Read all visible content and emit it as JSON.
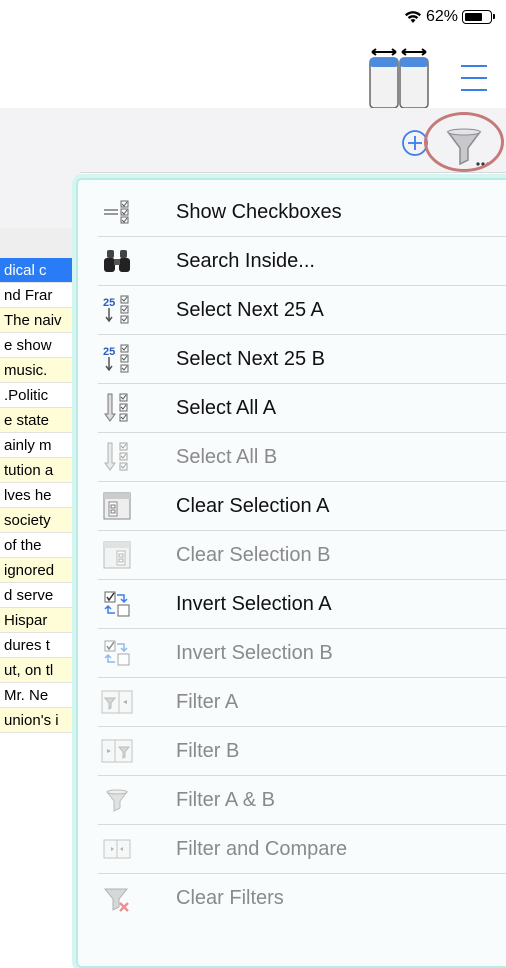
{
  "status_bar": {
    "battery_percent": "62%"
  },
  "toolbar": {
    "columns_icon": "two-columns-icon",
    "menu_icon": "hamburger-icon",
    "add_icon": "plus-circle-icon",
    "filter_icon": "filter-funnel-icon"
  },
  "background_rows": [
    "dical c",
    "nd Frar",
    "The naiv",
    "e show",
    " music.",
    ".Politic",
    "e state",
    "ainly m",
    "tution a",
    "lves he",
    "society",
    " of the",
    "ignored",
    "d serve",
    " Hispar",
    "dures t",
    "ut, on tl",
    "Mr. Ne",
    "union's i"
  ],
  "menu": {
    "items": [
      {
        "label": "Show Checkboxes",
        "icon": "checkbox-list-icon",
        "enabled": true
      },
      {
        "label": "Search Inside...",
        "icon": "binoculars-icon",
        "enabled": true
      },
      {
        "label": "Select Next 25 A",
        "icon": "select-25-icon",
        "enabled": true
      },
      {
        "label": "Select Next 25 B",
        "icon": "select-25-icon",
        "enabled": true
      },
      {
        "label": "Select All A",
        "icon": "select-all-icon",
        "enabled": true
      },
      {
        "label": "Select All B",
        "icon": "select-all-icon",
        "enabled": false
      },
      {
        "label": "Clear Selection A",
        "icon": "clear-selection-icon",
        "enabled": true
      },
      {
        "label": "Clear Selection B",
        "icon": "clear-selection-icon",
        "enabled": false
      },
      {
        "label": "Invert Selection A",
        "icon": "invert-selection-icon",
        "enabled": true
      },
      {
        "label": "Invert Selection B",
        "icon": "invert-selection-icon",
        "enabled": false
      },
      {
        "label": "Filter A",
        "icon": "filter-a-icon",
        "enabled": false
      },
      {
        "label": "Filter B",
        "icon": "filter-b-icon",
        "enabled": false
      },
      {
        "label": "Filter A & B",
        "icon": "filter-funnel-icon",
        "enabled": false
      },
      {
        "label": "Filter and Compare",
        "icon": "filter-compare-icon",
        "enabled": false
      },
      {
        "label": "Clear Filters",
        "icon": "clear-filter-icon",
        "enabled": false
      }
    ]
  },
  "colors": {
    "selected_row": "#2a7bf6",
    "highlight_row": "#fffcd8",
    "popup_border": "#b8ece6",
    "accent_blue": "#3a7ee8",
    "ring": "#c47a78"
  }
}
